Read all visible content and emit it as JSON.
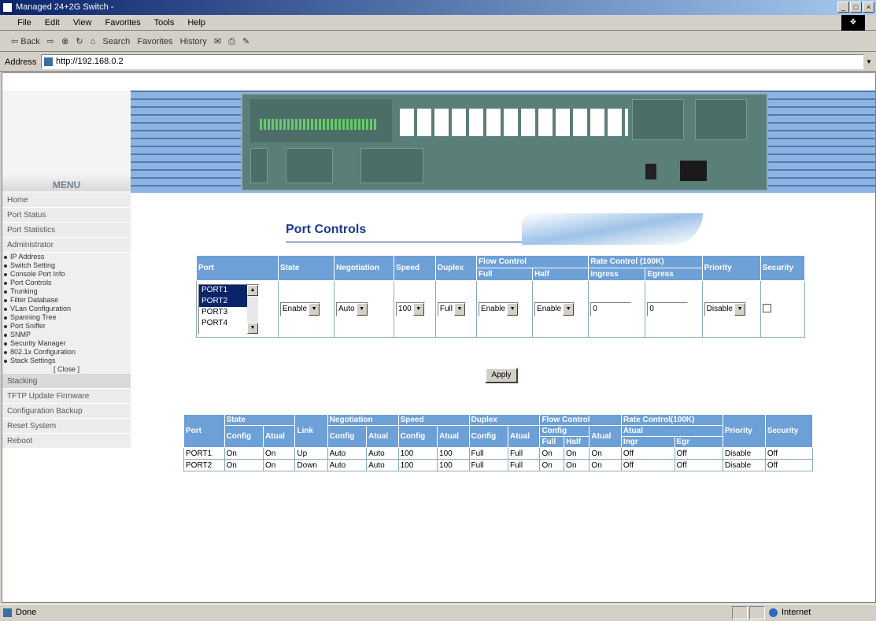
{
  "window": {
    "title": "Managed 24+2G Switch -",
    "buttons": [
      "_",
      "□",
      "×"
    ]
  },
  "menubar": {
    "items": [
      "File",
      "Edit",
      "View",
      "Favorites",
      "Tools",
      "Help"
    ]
  },
  "toolbar": {
    "back": "⇦ Back",
    "forward": "⇨",
    "search": "Search",
    "favorites": "Favorites",
    "history": "History"
  },
  "addressbar": {
    "label": "Address",
    "value": "http://192.168.0.2"
  },
  "menu": {
    "title": "MENU",
    "top": [
      "Home",
      "Port Status",
      "Port Statistics",
      "Administrator"
    ],
    "subs": [
      "IP Address",
      "Switch Setting",
      "Console Port Info",
      "Port Controls",
      "Trunking",
      "Filter Database",
      "VLan Configuration",
      "Spanning Tree",
      "Port Sniffer",
      "SNMP",
      "Security Manager",
      "802.1x Configuration",
      "Stack Settings"
    ],
    "close": "[ Close ]",
    "bottom": [
      "Stacking",
      "TFTP Update Firmware",
      "Configuration Backup",
      "Reset System",
      "Reboot"
    ]
  },
  "page": {
    "title": "Port Controls"
  },
  "controls": {
    "h": {
      "port": "Port",
      "state": "State",
      "negotiation": "Negotiation",
      "speed": "Speed",
      "duplex": "Duplex",
      "flow": "Flow Control",
      "full": "Full",
      "half": "Half",
      "rate": "Rate Control (100K)",
      "ingress": "Ingress",
      "egress": "Egress",
      "priority": "Priority",
      "security": "Security"
    },
    "ports": [
      "PORT1",
      "PORT2",
      "PORT3",
      "PORT4"
    ],
    "state": "Enable",
    "negotiation": "Auto",
    "speed": "100",
    "duplex": "Full",
    "flow_full": "Enable",
    "flow_half": "Enable",
    "ingress": "0",
    "egress": "0",
    "priority": "Disable",
    "apply": "Apply"
  },
  "status": {
    "h": {
      "port": "Port",
      "state": "State",
      "link": "Link",
      "negotiation": "Negotiation",
      "speed": "Speed",
      "duplex": "Duplex",
      "flow": "Flow Control",
      "rate": "Rate Control(100K)",
      "priority": "Priority",
      "security": "Security",
      "config": "Config",
      "atual": "Atual",
      "full": "Full",
      "half": "Half",
      "ingr": "Ingr",
      "egr": "Egr"
    },
    "rows": [
      [
        "PORT1",
        "On",
        "On",
        "Up",
        "Auto",
        "Auto",
        "100",
        "100",
        "Full",
        "Full",
        "On",
        "On",
        "On",
        "Off",
        "Off",
        "Disable",
        "Off"
      ],
      [
        "PORT2",
        "On",
        "On",
        "Down",
        "Auto",
        "Auto",
        "100",
        "100",
        "Full",
        "Full",
        "On",
        "On",
        "On",
        "Off",
        "Off",
        "Disable",
        "Off"
      ]
    ]
  },
  "statusbar": {
    "text": "Done",
    "zone": "Internet"
  }
}
